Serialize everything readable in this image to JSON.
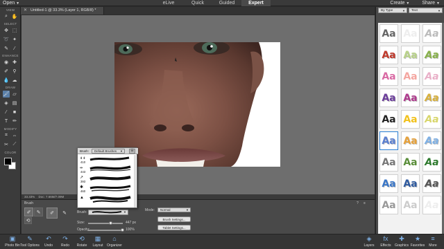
{
  "topbar": {
    "open_label": "Open",
    "modes": [
      "eLive",
      "Quick",
      "Guided",
      "Expert"
    ],
    "active_mode": "Expert",
    "create_label": "Create",
    "share_label": "Share"
  },
  "document_tab": {
    "title": "Untitled-1 @ 33.3% (Layer 1, RGB/8) *"
  },
  "toolbox": {
    "sections": [
      "VIEW",
      "SELECT",
      "ENHANCE",
      "DRAW",
      "MODIFY",
      "COLOR"
    ]
  },
  "status": {
    "zoom": "33.33%",
    "doc": "Doc: 7.66M/7.09M"
  },
  "tool_options": {
    "tool_name": "Brush",
    "brush_label": "Brush:",
    "size_label": "Size:",
    "size_value": "447 px",
    "opacity_label": "Opacity:",
    "opacity_value": "100%",
    "mode_label": "Mode:",
    "mode_value": "Normal",
    "brush_settings": "Brush Settings...",
    "tablet_settings": "Tablet Settings..."
  },
  "brush_popup": {
    "label": "Brush:",
    "library": "Default Brushes",
    "sizes": [
      "410",
      "443",
      "393",
      "460"
    ]
  },
  "right_panel": {
    "filter_value": "By Type",
    "category_value": "Text",
    "tile_text": "Aa"
  },
  "taskbar": {
    "left": [
      {
        "label": "Photo Bin",
        "icon": "photo-bin-icon"
      },
      {
        "label": "Tool Options",
        "icon": "tool-options-icon"
      },
      {
        "label": "Undo",
        "icon": "undo-icon"
      },
      {
        "label": "Redo",
        "icon": "redo-icon"
      },
      {
        "label": "Rotate",
        "icon": "rotate-icon"
      },
      {
        "label": "Layout",
        "icon": "layout-icon"
      },
      {
        "label": "Organizer",
        "icon": "organizer-icon"
      }
    ],
    "right": [
      {
        "label": "Layers",
        "icon": "layers-icon"
      },
      {
        "label": "Effects",
        "icon": "effects-icon"
      },
      {
        "label": "Graphics",
        "icon": "graphics-icon"
      },
      {
        "label": "Favorites",
        "icon": "favorites-icon"
      },
      {
        "label": "More",
        "icon": "more-icon"
      }
    ]
  },
  "colors": {
    "foreground": "#000000",
    "background": "#ffffff",
    "accent": "#2a7fd4"
  }
}
